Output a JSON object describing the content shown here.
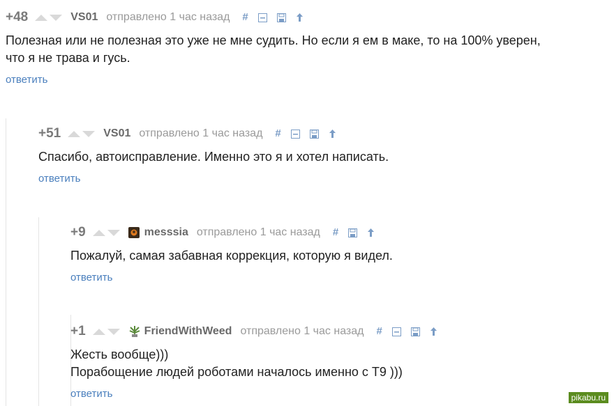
{
  "comments": [
    {
      "rating": "+48",
      "author": "VS01",
      "time": "отправлено 1 час назад",
      "lines": [
        "Полезная или не полезная это уже не мне судить. Но если я ем в маке, то на 100% уверен,",
        "что я не трава и гусь."
      ],
      "reply": "ответить"
    },
    {
      "rating": "+51",
      "author": "VS01",
      "time": "отправлено 1 час назад",
      "lines": [
        "Спасибо, автоисправление. Именно это я и хотел написать."
      ],
      "reply": "ответить"
    },
    {
      "rating": "+9",
      "author": "messsia",
      "time": "отправлено 1 час назад",
      "lines": [
        "Пожалуй, самая забавная коррекция, которую я видел."
      ],
      "reply": "ответить"
    },
    {
      "rating": "+1",
      "author": "FriendWithWeed",
      "time": "отправлено 1 час назад",
      "lines": [
        "Жесть вообще)))",
        "Порабощение людей роботами началось именно с Т9 )))"
      ],
      "reply": "ответить"
    }
  ],
  "icons": {
    "link": "hash-icon",
    "collapse": "collapse-icon",
    "save": "save-icon",
    "parent": "arrow-up-icon"
  },
  "colors": {
    "reply_link": "#4a7fbd",
    "tool_icons": "#7b9dc6",
    "rating": "#7a7a7a"
  },
  "watermark": "pikabu.ru"
}
